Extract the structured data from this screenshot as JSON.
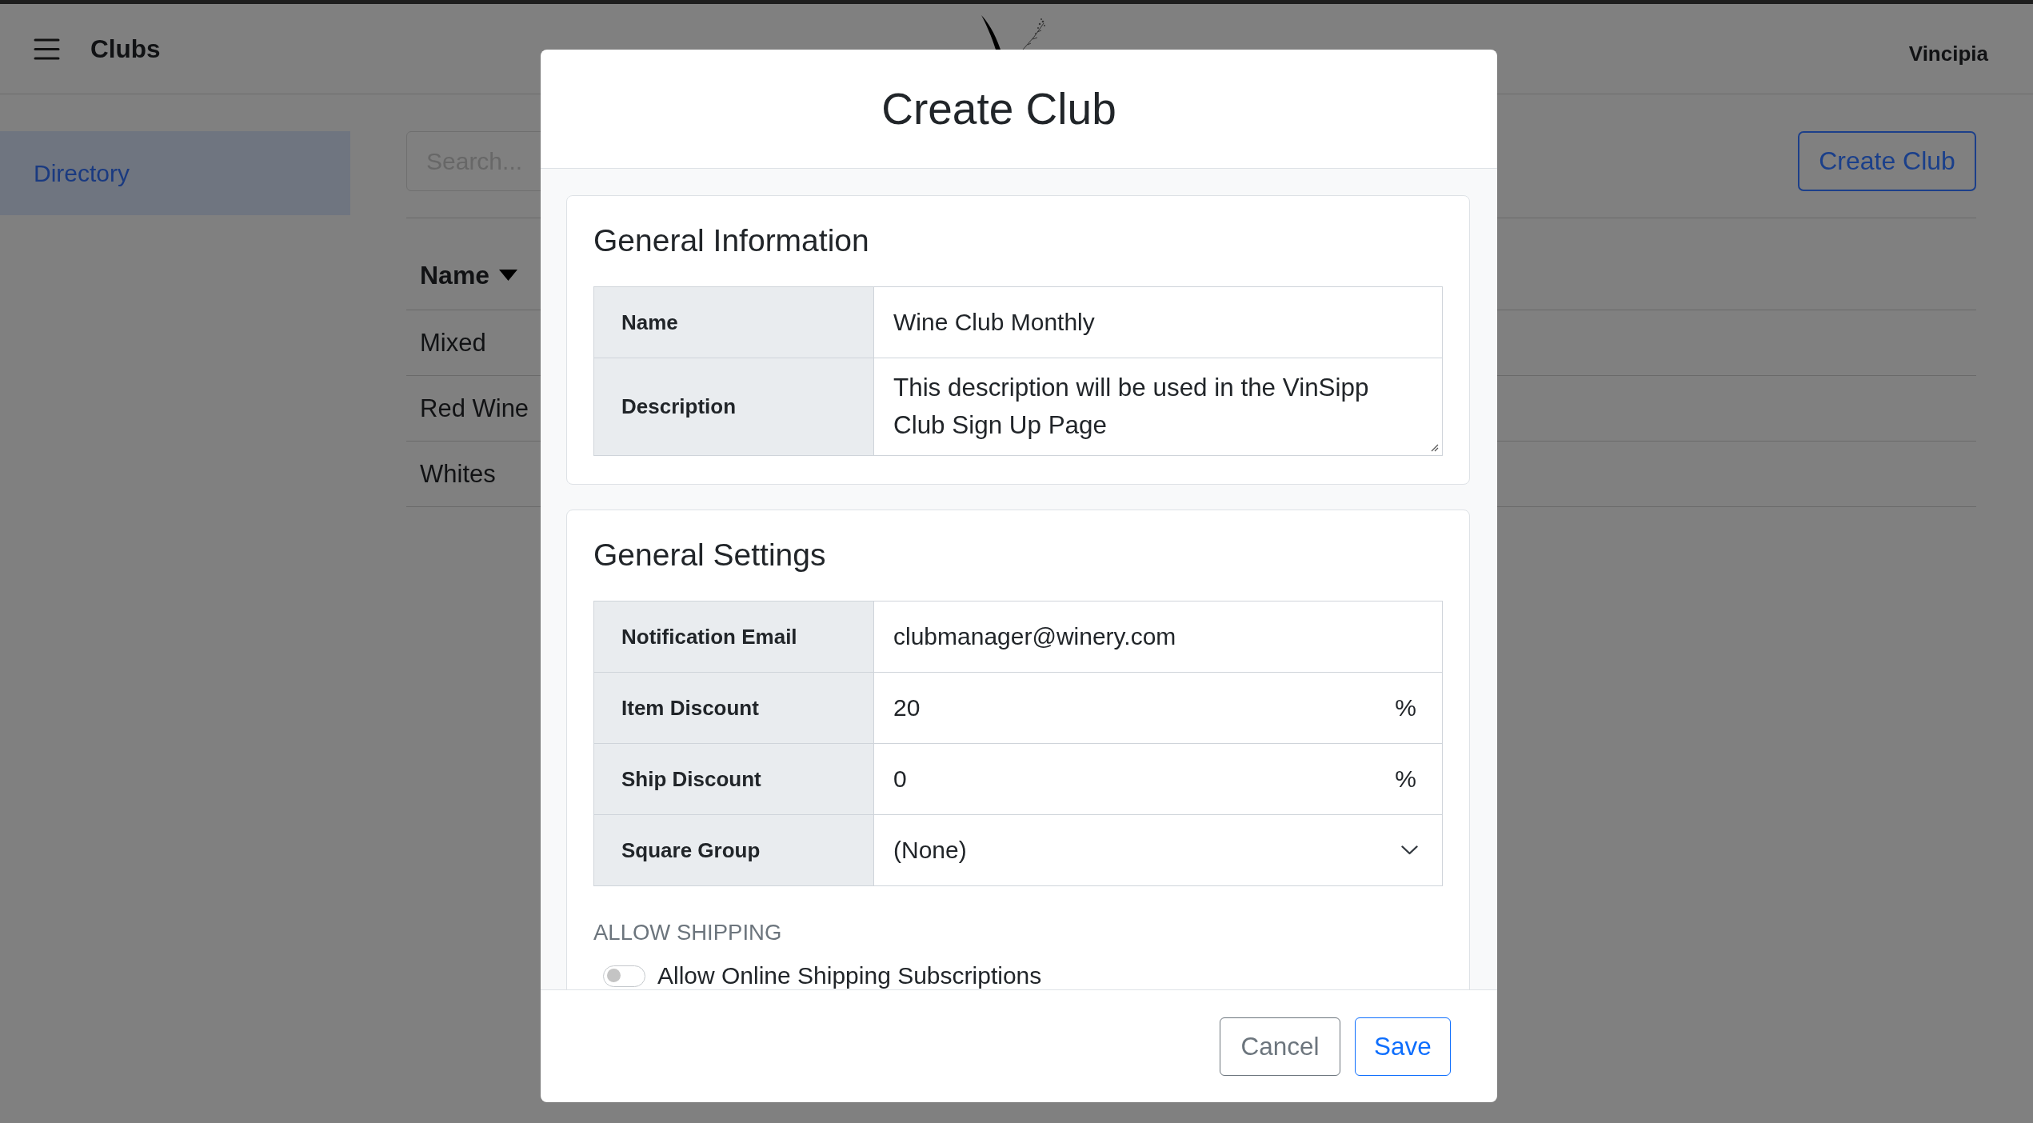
{
  "header": {
    "title": "Clubs",
    "account": "Vincipia"
  },
  "sidebar": {
    "items": [
      {
        "label": "Directory",
        "selected": true
      }
    ]
  },
  "toolbar": {
    "search": {
      "placeholder": "Search..."
    },
    "create_button": "Create Club"
  },
  "table": {
    "columns": [
      {
        "label": "Name",
        "sorted": true,
        "descending": true
      }
    ],
    "rows": [
      {
        "name": "Mixed"
      },
      {
        "name": "Red Wine"
      },
      {
        "name": "Whites"
      }
    ]
  },
  "modal": {
    "title": "Create Club",
    "sections": [
      {
        "title": "General Information",
        "fields": [
          {
            "kind": "text",
            "label": "Name",
            "value": "Wine Club Monthly"
          },
          {
            "kind": "textarea",
            "label": "Description",
            "value": "This description will be used in the VinSipp Club Sign Up Page"
          }
        ]
      },
      {
        "title": "General Settings",
        "fields": [
          {
            "kind": "text",
            "label": "Notification Email",
            "value": "clubmanager@winery.com"
          },
          {
            "kind": "percent",
            "label": "Item Discount",
            "value": "20",
            "suffix": "%"
          },
          {
            "kind": "percent",
            "label": "Ship Discount",
            "value": "0",
            "suffix": "%"
          },
          {
            "kind": "select",
            "label": "Square Group",
            "value": "(None)"
          }
        ],
        "groups": [
          {
            "heading": "ALLOW SHIPPING",
            "toggles": [
              {
                "label": "Allow Online Shipping Subscriptions",
                "on": false
              }
            ]
          }
        ]
      }
    ],
    "buttons": [
      {
        "label": "Cancel",
        "kind": "secondary"
      },
      {
        "label": "Save",
        "kind": "primary"
      }
    ]
  }
}
